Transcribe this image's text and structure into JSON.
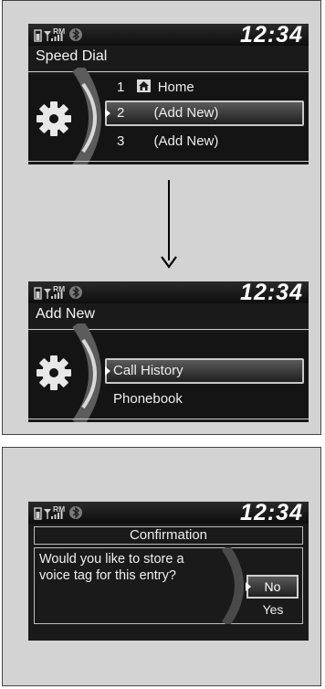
{
  "colors": {
    "screen_bg": "#1a1a1a",
    "panel_bg": "#d3d3d3",
    "highlight_border": "#c8c8c8",
    "text": "#f2f2f2"
  },
  "icons": [
    "phone-battery-icon",
    "signal-strength-icon",
    "roaming-indicator-icon",
    "bluetooth-icon",
    "gear-icon",
    "home-icon",
    "down-arrow-icon"
  ],
  "speed_dial": {
    "status": {
      "roaming": "RM",
      "clock": "12:34"
    },
    "title": "Speed Dial",
    "items": [
      {
        "number": "1",
        "label": "Home"
      },
      {
        "number": "2",
        "label": "(Add New)"
      },
      {
        "number": "3",
        "label": "(Add New)"
      }
    ],
    "selected_index": 1
  },
  "add_new": {
    "status": {
      "roaming": "RM",
      "clock": "12:34"
    },
    "title": "Add New",
    "items": [
      {
        "label": "Call History"
      },
      {
        "label": "Phonebook"
      }
    ],
    "selected_index": 0
  },
  "confirmation": {
    "status": {
      "roaming": "RM",
      "clock": "12:34"
    },
    "title": "Confirmation",
    "message_line1": "Would you like to store a",
    "message_line2": "voice tag for this entry?",
    "options": {
      "no": "No",
      "yes": "Yes"
    },
    "selected": "No"
  }
}
